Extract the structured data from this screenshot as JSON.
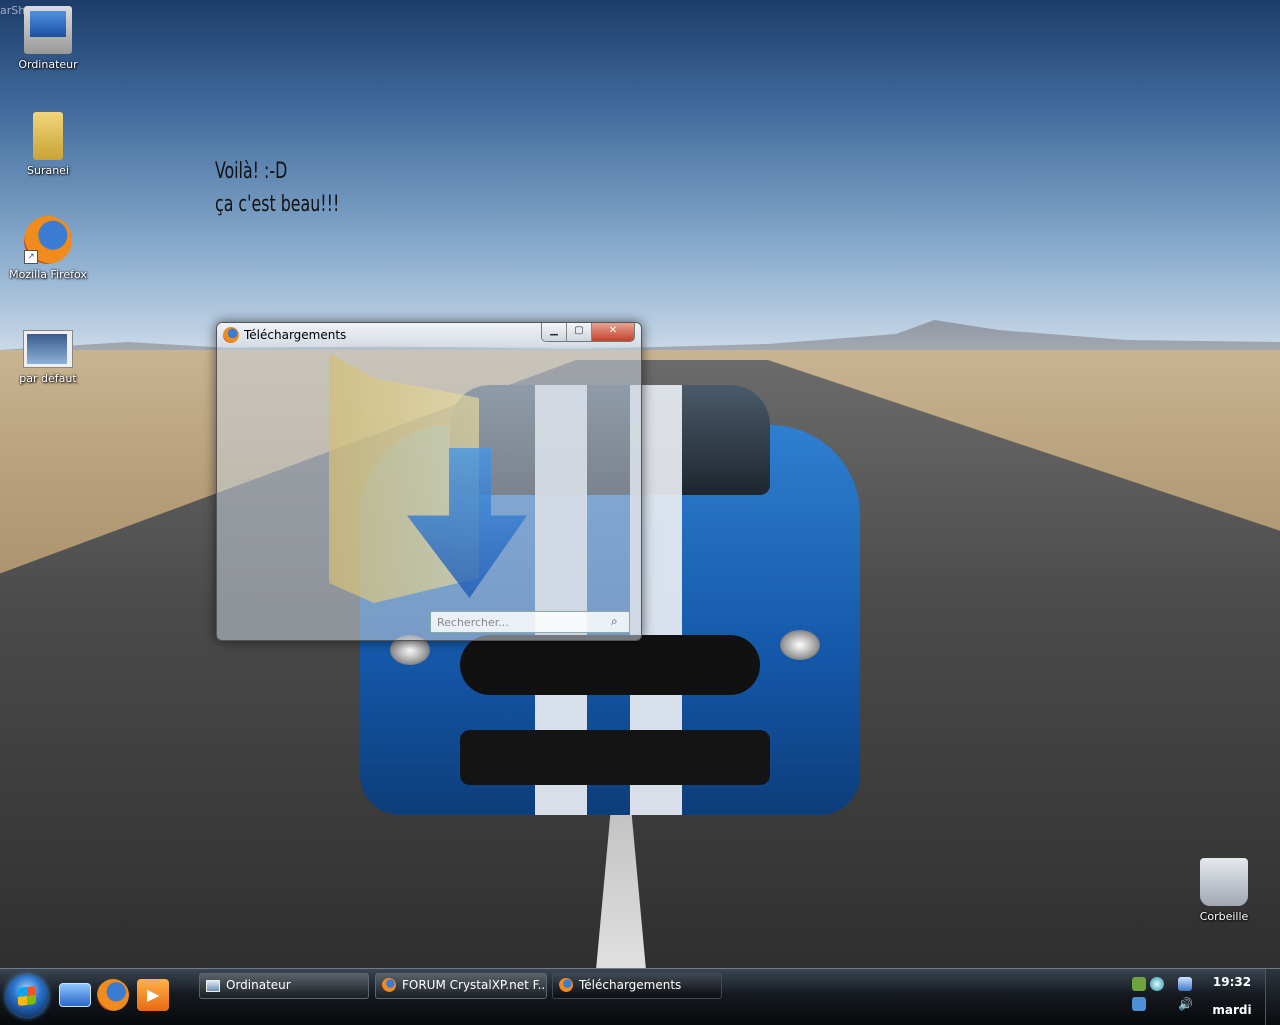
{
  "watermark": "arShot",
  "desktop": {
    "icons": [
      {
        "label": "Ordinateur",
        "icon": "computer-icon"
      },
      {
        "label": "Suranei",
        "icon": "folder-icon"
      },
      {
        "label": "Mozilla Firefox",
        "icon": "firefox-icon"
      },
      {
        "label": "par défaut",
        "icon": "screenshot-icon"
      },
      {
        "label": "Corbeille",
        "icon": "recycle-bin-icon"
      }
    ],
    "note_line1": "Voilà! :-D",
    "note_line2": "ça c'est beau!!!"
  },
  "downloads_window": {
    "title": "Téléchargements",
    "minimize": "▁",
    "maximize": "▢",
    "close": "✕",
    "search_placeholder": "Rechercher..."
  },
  "taskbar": {
    "tasks": [
      {
        "label": "Ordinateur",
        "icon": "computer-icon",
        "active": false
      },
      {
        "label": "FORUM CrystalXP.net F...",
        "icon": "firefox-icon",
        "active": false
      },
      {
        "label": "Téléchargements",
        "icon": "firefox-icon",
        "active": true
      }
    ],
    "clock_time": "19:32",
    "clock_day": "mardi"
  }
}
